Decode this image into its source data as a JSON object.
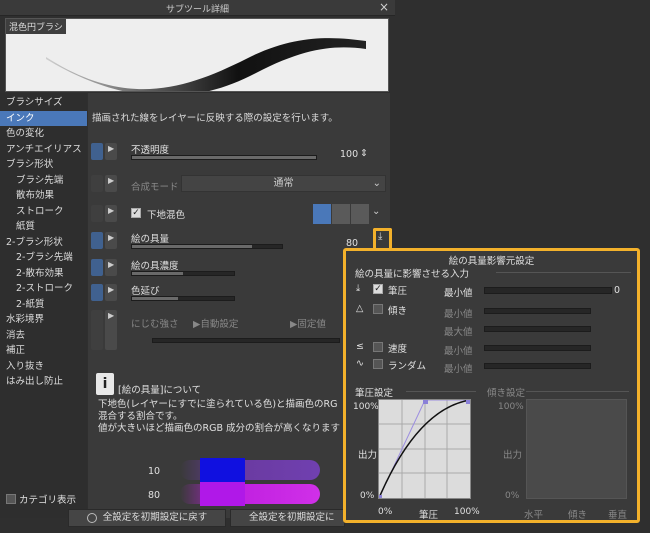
{
  "window": {
    "title": "サブツール詳細",
    "close": "×"
  },
  "preview": {
    "label": "混色円ブラシ"
  },
  "sidebar": {
    "items": [
      {
        "label": "ブラシサイズ",
        "sub": false,
        "active": false
      },
      {
        "label": "インク",
        "sub": false,
        "active": true
      },
      {
        "label": "色の変化",
        "sub": false,
        "active": false
      },
      {
        "label": "アンチエイリアス",
        "sub": false,
        "active": false
      },
      {
        "label": "ブラシ形状",
        "sub": false,
        "active": false
      },
      {
        "label": "ブラシ先端",
        "sub": true,
        "active": false
      },
      {
        "label": "散布効果",
        "sub": true,
        "active": false
      },
      {
        "label": "ストローク",
        "sub": true,
        "active": false
      },
      {
        "label": "紙質",
        "sub": true,
        "active": false
      },
      {
        "label": "2-ブラシ形状",
        "sub": false,
        "active": false
      },
      {
        "label": "2-ブラシ先端",
        "sub": true,
        "active": false
      },
      {
        "label": "2-散布効果",
        "sub": true,
        "active": false
      },
      {
        "label": "2-ストローク",
        "sub": true,
        "active": false
      },
      {
        "label": "2-紙質",
        "sub": true,
        "active": false
      },
      {
        "label": "水彩境界",
        "sub": false,
        "active": false
      },
      {
        "label": "消去",
        "sub": false,
        "active": false
      },
      {
        "label": "補正",
        "sub": false,
        "active": false
      },
      {
        "label": "入り抜き",
        "sub": false,
        "active": false
      },
      {
        "label": "はみ出し防止",
        "sub": false,
        "active": false
      }
    ],
    "category_label": "カテゴリ表示"
  },
  "content": {
    "description": "描画された線をレイヤーに反映する際の設定を行います。",
    "opacity": {
      "label": "不透明度",
      "value": "100",
      "level": 1.0
    },
    "blend_mode": {
      "label": "合成モード",
      "value": "通常"
    },
    "underlay": {
      "label": "下地混色"
    },
    "paint_amount": {
      "label": "絵の具量",
      "value": "80",
      "level": 0.8
    },
    "paint_density": {
      "label": "絵の具濃度",
      "level": 0.5
    },
    "color_stretch": {
      "label": "色延び",
      "level": 0.45
    },
    "blur": {
      "label": "にじむ強さ",
      "auto": "自動設定",
      "fixed": "固定値"
    },
    "info": {
      "icon": "i",
      "title": "[絵の具量]について",
      "lines": [
        "下地色(レイヤーにすでに塗られている色)と描画色のRG",
        "混合する割合です。",
        "値が大きいほど描画色のRGB 成分の割合が高くなります"
      ],
      "sample_values": [
        "10",
        "80"
      ]
    },
    "reset_button": "全設定を初期設定に戻す",
    "register_button": "全設定を初期設定に"
  },
  "popup": {
    "title": "絵の具量影響元設定",
    "section_inputs": "絵の具量に影響させる入力",
    "inputs": [
      {
        "label": "筆圧",
        "checked": true,
        "min_label": "最小値",
        "value": "0",
        "enabled": true
      },
      {
        "label": "傾き",
        "checked": false,
        "min_label": "最小値",
        "max_label": "最大値",
        "enabled": false
      },
      {
        "label": "速度",
        "checked": false,
        "min_label": "最小値",
        "enabled": false
      },
      {
        "label": "ランダム",
        "checked": false,
        "min_label": "最小値",
        "enabled": false
      }
    ],
    "pressure_graph": {
      "title": "筆圧設定",
      "y_label": "出力",
      "y_top": "100%",
      "y_bottom": "0%",
      "x_label": "筆圧",
      "x_left": "0%",
      "x_right": "100%"
    },
    "tilt_graph": {
      "title": "傾き設定",
      "y_label": "出力",
      "y_top": "100%",
      "y_bottom": "0%",
      "x_labels": [
        "水平",
        "傾き",
        "垂直"
      ]
    }
  },
  "colors": {
    "accent": "#f3b12b",
    "selected": "#4a78b9"
  }
}
